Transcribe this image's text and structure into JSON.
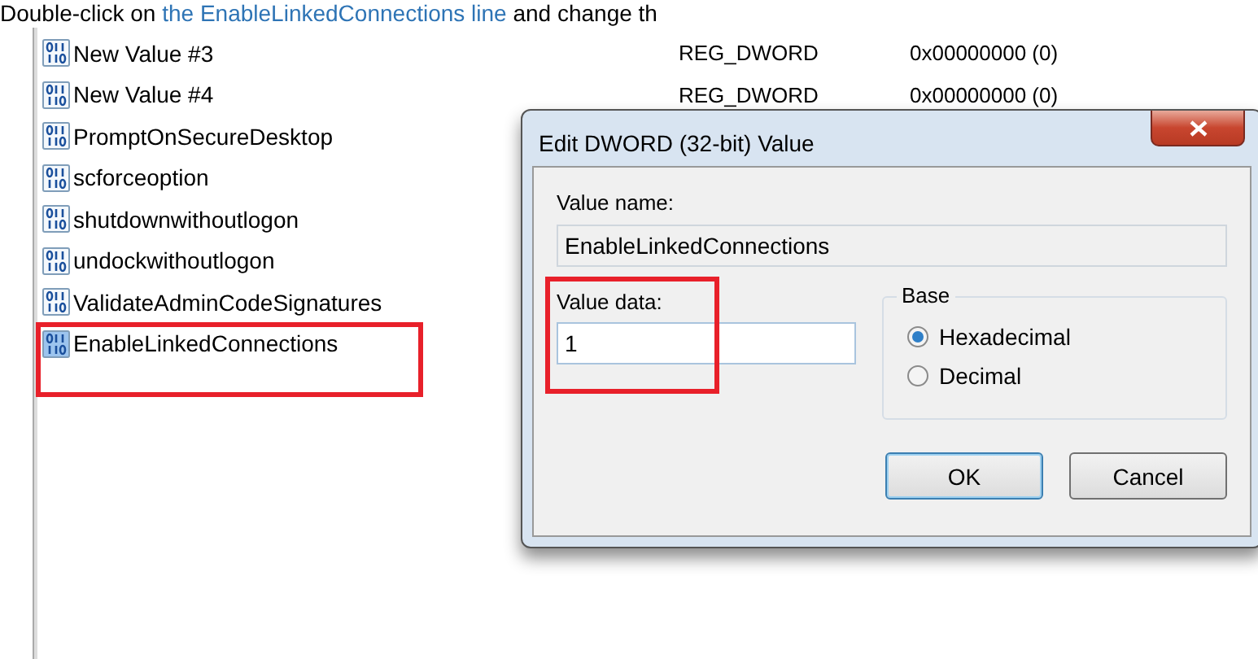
{
  "instruction": {
    "text": "Double-click on ",
    "link": "the EnableLinkedConnections line",
    "rest": " and change th"
  },
  "registry_values": [
    {
      "name": "New Value #3",
      "type": "REG_DWORD",
      "data": "0x00000000 (0)",
      "selected": false,
      "highlighted": false
    },
    {
      "name": "New Value #4",
      "type": "REG_DWORD",
      "data": "0x00000000 (0)",
      "selected": false,
      "highlighted": false
    },
    {
      "name": "PromptOnSecureDesktop",
      "selected": false,
      "highlighted": false
    },
    {
      "name": "scforceoption",
      "selected": false,
      "highlighted": false
    },
    {
      "name": "shutdownwithoutlogon",
      "selected": false,
      "highlighted": false
    },
    {
      "name": "undockwithoutlogon",
      "selected": false,
      "highlighted": false
    },
    {
      "name": "ValidateAdminCodeSignatures",
      "selected": false,
      "highlighted": false
    },
    {
      "name": "EnableLinkedConnections",
      "selected": true,
      "highlighted": true
    }
  ],
  "dialog": {
    "title": "Edit DWORD (32-bit) Value",
    "value_name_label": "Value name:",
    "value_name": "EnableLinkedConnections",
    "value_data_label": "Value data:",
    "value_data": "1",
    "value_data_highlighted": true,
    "base": {
      "label": "Base",
      "options": [
        {
          "label": "Hexadecimal",
          "selected": true
        },
        {
          "label": "Decimal",
          "selected": false
        }
      ]
    },
    "buttons": [
      {
        "label": "OK",
        "default": true
      },
      {
        "label": "Cancel",
        "default": false
      }
    ]
  }
}
